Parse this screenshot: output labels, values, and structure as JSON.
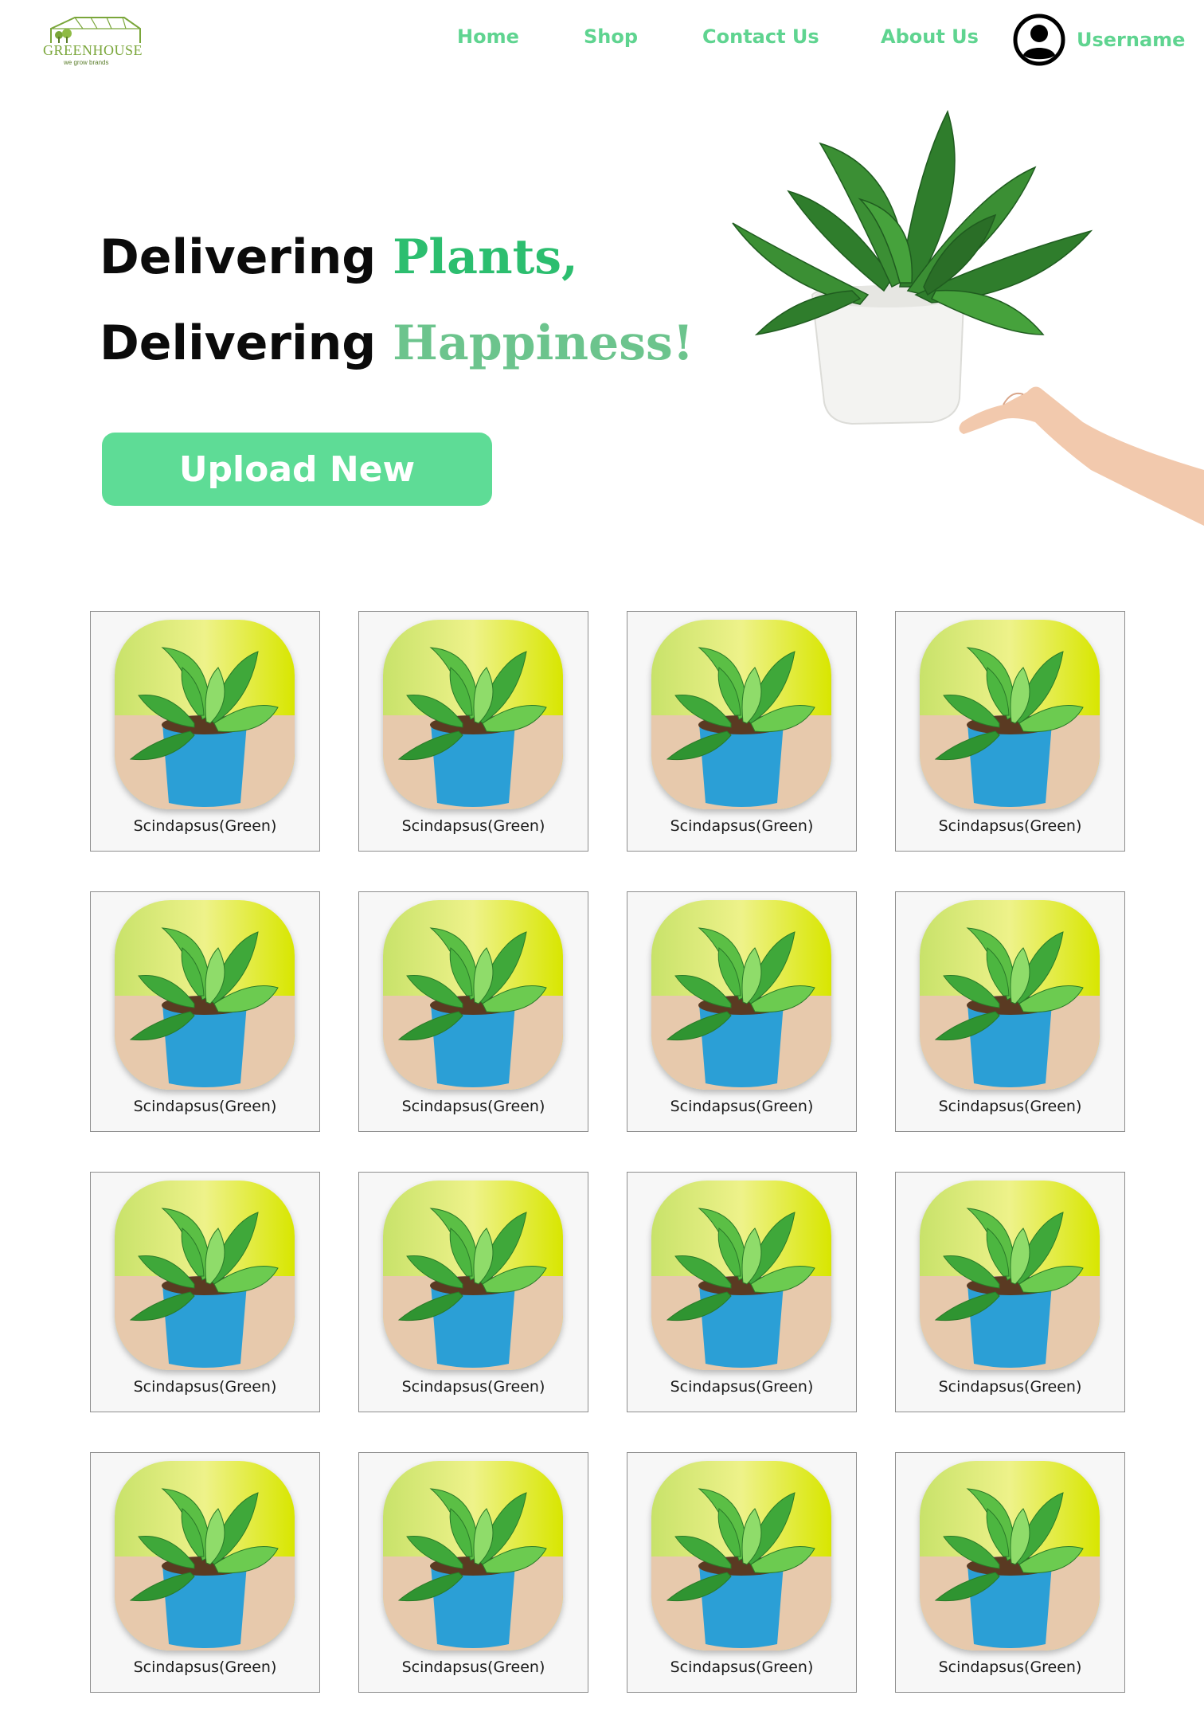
{
  "logo": {
    "name": "GREENHOUSE",
    "tagline": "we grow brands",
    "icon": "greenhouse-logo"
  },
  "nav": {
    "home": "Home",
    "shop": "Shop",
    "contact": "Contact Us",
    "about": "About Us"
  },
  "user": {
    "name": "Username",
    "icon": "user-avatar-icon"
  },
  "hero": {
    "line1_prefix": "Delivering",
    "line1_accent": "Plants,",
    "line2_prefix": "Delivering",
    "line2_accent": "Happiness!",
    "cta": "Upload New",
    "image": "plant-in-hand-photo"
  },
  "colors": {
    "accent": "#5edc96",
    "nav": "#5fd490",
    "plants": "#2cbe6f",
    "happiness": "#6cc48d"
  },
  "products": [
    {
      "name": "Scindapsus(Green)",
      "image": "pothos-blue-pot"
    },
    {
      "name": "Scindapsus(Green)",
      "image": "pothos-blue-pot"
    },
    {
      "name": "Scindapsus(Green)",
      "image": "pothos-blue-pot"
    },
    {
      "name": "Scindapsus(Green)",
      "image": "pothos-blue-pot"
    },
    {
      "name": "Scindapsus(Green)",
      "image": "pothos-blue-pot"
    },
    {
      "name": "Scindapsus(Green)",
      "image": "pothos-blue-pot"
    },
    {
      "name": "Scindapsus(Green)",
      "image": "pothos-blue-pot"
    },
    {
      "name": "Scindapsus(Green)",
      "image": "pothos-blue-pot"
    },
    {
      "name": "Scindapsus(Green)",
      "image": "pothos-blue-pot"
    },
    {
      "name": "Scindapsus(Green)",
      "image": "pothos-blue-pot"
    },
    {
      "name": "Scindapsus(Green)",
      "image": "pothos-blue-pot"
    },
    {
      "name": "Scindapsus(Green)",
      "image": "pothos-blue-pot"
    },
    {
      "name": "Scindapsus(Green)",
      "image": "pothos-blue-pot"
    },
    {
      "name": "Scindapsus(Green)",
      "image": "pothos-blue-pot"
    },
    {
      "name": "Scindapsus(Green)",
      "image": "pothos-blue-pot"
    },
    {
      "name": "Scindapsus(Green)",
      "image": "pothos-blue-pot"
    }
  ]
}
